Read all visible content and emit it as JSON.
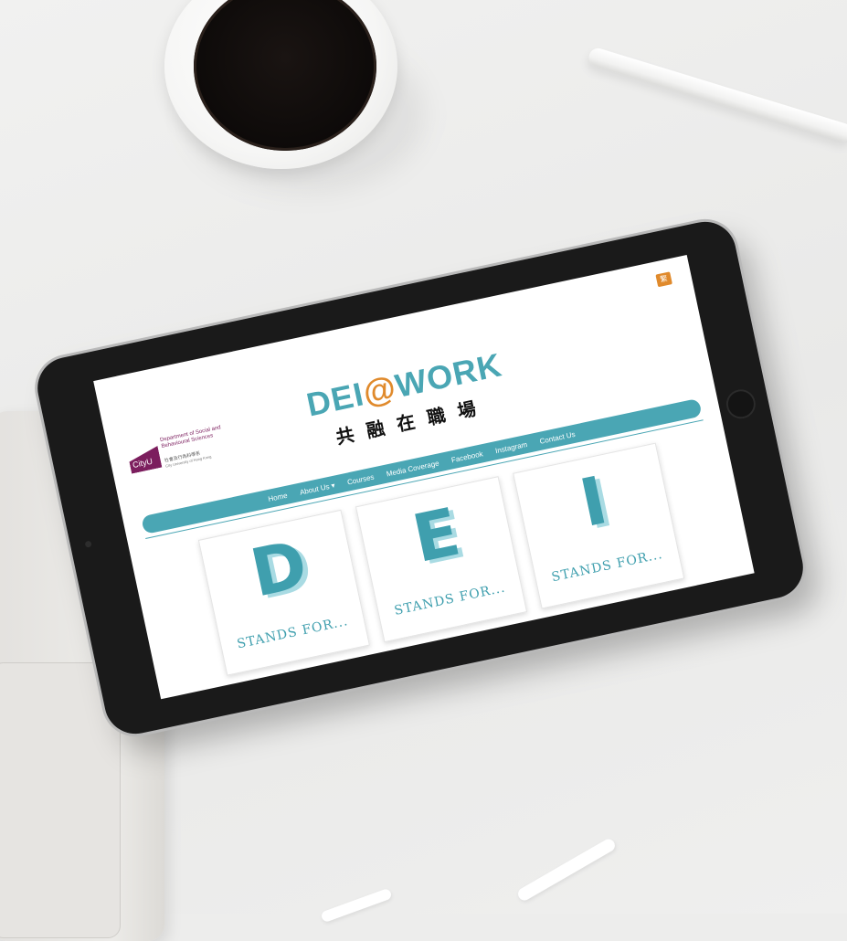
{
  "site": {
    "language_toggle": "繁",
    "logo": {
      "mark_text": "CityU",
      "department": "Department of Social and Behavioural Sciences",
      "chinese_name": "社會及行為科學系",
      "english_name": "City University of Hong Kong"
    },
    "brand": {
      "title_prefix": "DEI",
      "title_at": "@",
      "title_suffix": "WORK",
      "subtitle": "共融在職場"
    },
    "nav": {
      "items": [
        {
          "label": "Home"
        },
        {
          "label": "About Us ▾"
        },
        {
          "label": "Courses"
        },
        {
          "label": "Media Coverage"
        },
        {
          "label": "Facebook"
        },
        {
          "label": "Instagram"
        },
        {
          "label": "Contact Us"
        }
      ]
    },
    "cards": [
      {
        "letter": "D",
        "caption": "STANDS FOR..."
      },
      {
        "letter": "E",
        "caption": "STANDS FOR..."
      },
      {
        "letter": "I",
        "caption": "STANDS FOR..."
      }
    ]
  },
  "colors": {
    "accent_teal": "#4aa6b4",
    "accent_orange": "#e08a2c",
    "cityu_maroon": "#7c1e5e"
  }
}
